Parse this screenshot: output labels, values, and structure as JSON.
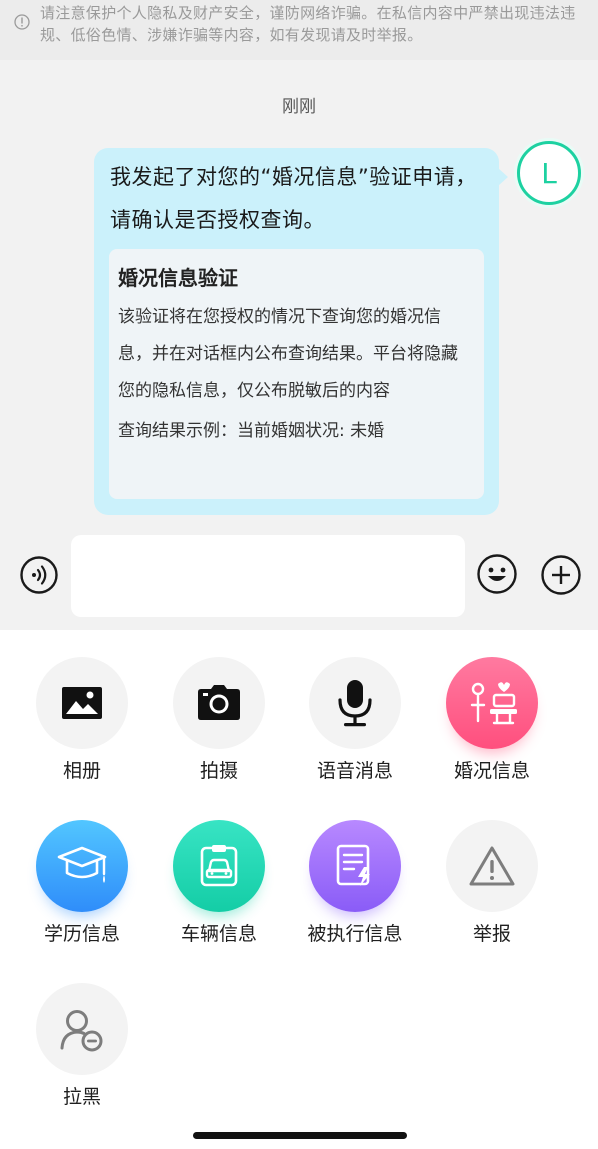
{
  "notice": {
    "text": "请注意保护个人隐私及财产安全，谨防网络诈骗。在私信内容中严禁出现违法违规、低俗色情、涉嫌诈骗等内容，如有发现请及时举报。"
  },
  "chat": {
    "timestamp": "刚刚",
    "avatar_letter": "L",
    "message": "我发起了对您的“婚况信息”验证申请，请确认是否授权查询。",
    "card": {
      "title": "婚况信息验证",
      "description": "该验证将在您授权的情况下查询您的婚况信息，并在对话框内公布查询结果。平台将隐藏您的隐私信息，仅公布脱敏后的内容",
      "example": "查询结果示例：当前婚姻状况: 未婚"
    }
  },
  "input": {
    "placeholder": ""
  },
  "panel": {
    "tools": [
      {
        "label": "相册",
        "icon": "photo-album-icon"
      },
      {
        "label": "拍摄",
        "icon": "camera-icon"
      },
      {
        "label": "语音消息",
        "icon": "microphone-icon"
      },
      {
        "label": "婚况信息",
        "icon": "marriage-icon",
        "color": "#ff5c88"
      },
      {
        "label": "学历信息",
        "icon": "graduation-cap-icon",
        "color": "#3a9dfb"
      },
      {
        "label": "车辆信息",
        "icon": "car-icon",
        "color": "#1fd6b0"
      },
      {
        "label": "被执行信息",
        "icon": "document-icon",
        "color": "#9a6cf9"
      },
      {
        "label": "举报",
        "icon": "warning-icon"
      },
      {
        "label": "拉黑",
        "icon": "block-user-icon"
      }
    ]
  }
}
